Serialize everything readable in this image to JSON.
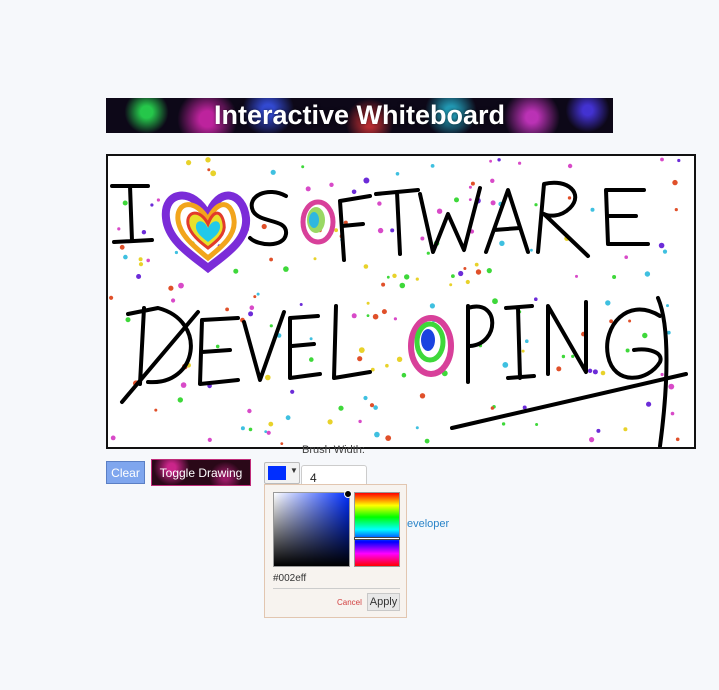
{
  "header": {
    "title": "Interactive Whiteboard"
  },
  "board": {
    "drawing_text_line1": "I ♥ SOFTWARE",
    "drawing_text_line2": "DEVELOPING"
  },
  "toolbar": {
    "clear_label": "Clear",
    "toggle_label": "Toggle Drawing",
    "brush_width_label": "Brush Width:",
    "brush_width_value": "4",
    "selected_color": "#002eff"
  },
  "color_picker": {
    "hex_value": "#002eff",
    "cancel_label": "Cancel",
    "apply_label": "Apply"
  },
  "footer": {
    "link_partial": "eveloper"
  },
  "colors": {
    "brand_blue": "#002eff",
    "clear_button": "#7fa6ee",
    "toggle_button_border": "#c02c7a",
    "link": "#2a84c8"
  }
}
